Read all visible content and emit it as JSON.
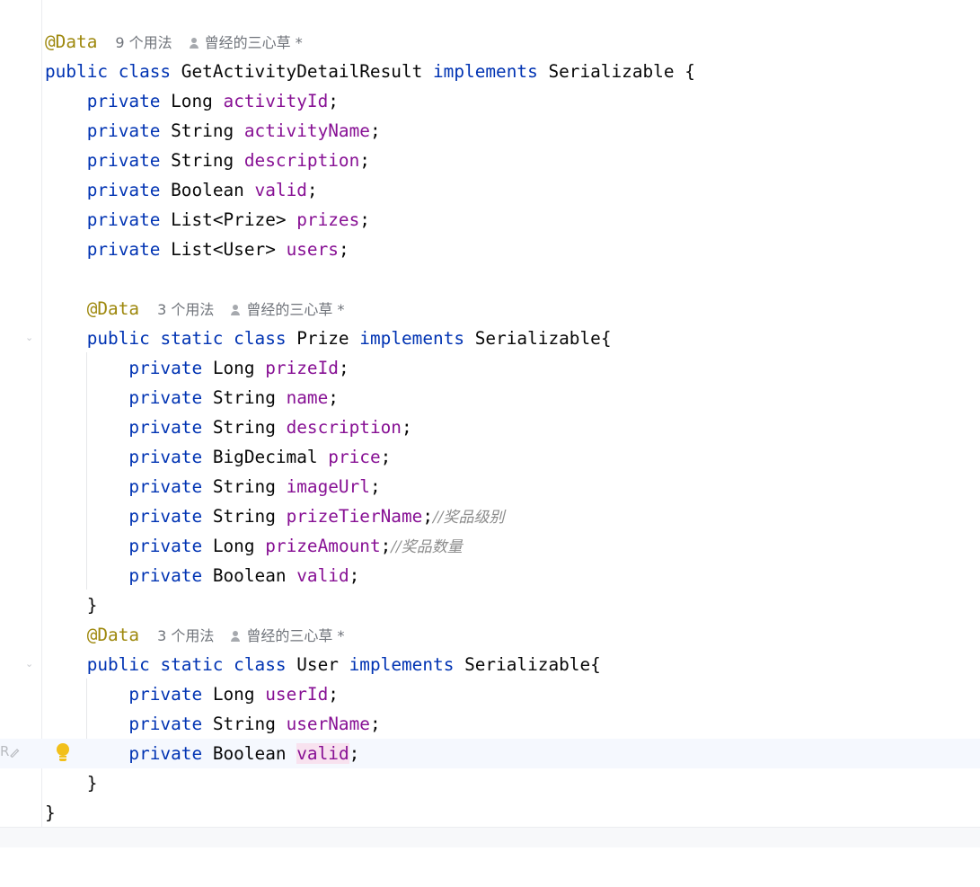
{
  "hints": {
    "outer_usages": "9 个用法",
    "inner_usages": "3 个用法",
    "author": "曾经的三心草",
    "modified_mark": "*"
  },
  "code": {
    "annotation": "@Data",
    "kw_public": "public",
    "kw_class": "class",
    "kw_static": "static",
    "kw_private": "private",
    "kw_implements": "implements",
    "class_name": "GetActivityDetailResult",
    "iface": "Serializable",
    "inner1": "Prize",
    "inner2": "User",
    "types": {
      "long": "Long",
      "string": "String",
      "boolean": "Boolean",
      "bigdecimal": "BigDecimal",
      "list_prize": "List<Prize>",
      "list_user": "List<User>"
    },
    "fields": {
      "activityId": "activityId",
      "activityName": "activityName",
      "description": "description",
      "valid": "valid",
      "prizes": "prizes",
      "users": "users",
      "prizeId": "prizeId",
      "name": "name",
      "price": "price",
      "imageUrl": "imageUrl",
      "prizeTierName": "prizeTierName",
      "prizeAmount": "prizeAmount",
      "userId": "userId",
      "userName": "userName"
    },
    "comments": {
      "tier": "奖品级别",
      "amount": "奖品数量"
    },
    "open_brace": "{",
    "close_brace": "}",
    "semicolon": ";",
    "comment_slash": "//"
  },
  "gutter": {
    "reader_mode_glyph": "R"
  },
  "colors": {
    "keyword": "#0033b3",
    "field": "#871094",
    "annotation": "#9e880d",
    "comment": "#8c8c8c",
    "current_line": "#f5f8fe",
    "bulb": "#f2c01b"
  }
}
